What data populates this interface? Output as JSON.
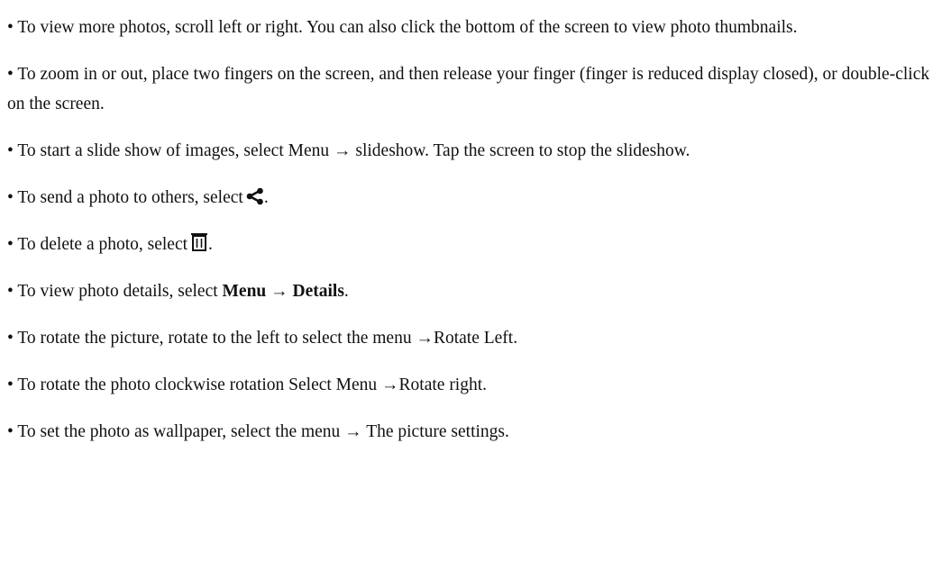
{
  "items": {
    "scroll": "• To view more photos, scroll left or right. You can also click the bottom of the screen to view photo thumbnails.",
    "zoom": "• To zoom in or out, place two fingers on the screen, and then release your finger (finger is reduced display closed), or double-click on the screen.",
    "slideshow": "• To start a slide show of images, select Menu → slideshow. Tap the screen to stop the slideshow.",
    "share": {
      "before": "• To send a photo to others, select",
      "after": ".",
      "icon": "share-icon"
    },
    "delete": {
      "before": "• To delete a photo, select",
      "after": ".",
      "icon": "trash-icon"
    },
    "details": {
      "before": "• To view photo details, select ",
      "menu": "Menu",
      "arrow": " → ",
      "details": "Details",
      "after": "."
    },
    "rotate_left": "• To rotate the picture, rotate to the left to select the menu →Rotate Left.",
    "rotate_right": "• To rotate the photo clockwise rotation Select Menu →Rotate right.",
    "wallpaper": "• To set the photo as wallpaper, select the menu → The picture settings."
  }
}
